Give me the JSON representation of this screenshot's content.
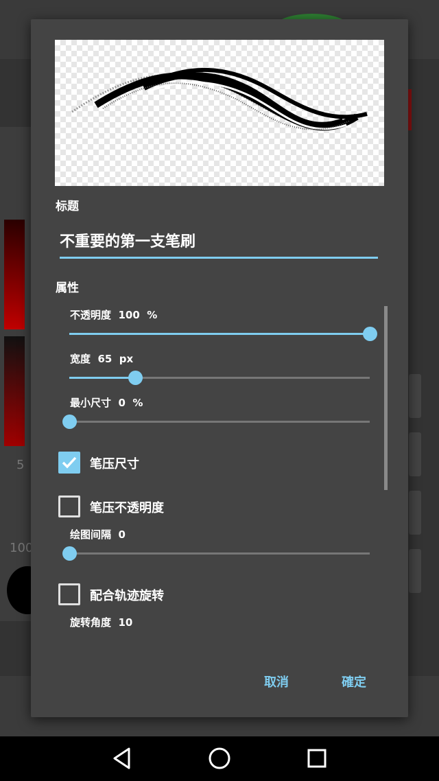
{
  "background": {
    "left_numbers": [
      "5",
      "100"
    ]
  },
  "dialog": {
    "title_label": "标题",
    "title_value": "不重要的第一支笔刷",
    "properties_label": "属性",
    "sliders": [
      {
        "name": "不透明度",
        "value": "100",
        "unit": "%",
        "fraction": 1.0
      },
      {
        "name": "宽度",
        "value": "65",
        "unit": "px",
        "fraction": 0.22
      },
      {
        "name": "最小尺寸",
        "value": "0",
        "unit": "%",
        "fraction": 0.0
      }
    ],
    "pressure_size": {
      "label": "笔压尺寸",
      "checked": true
    },
    "pressure_opacity": {
      "label": "笔压不透明度",
      "checked": false
    },
    "spacing": {
      "name": "绘图间隔",
      "value": "0",
      "unit": "",
      "fraction": 0.0
    },
    "follow_rotation": {
      "label": "配合轨迹旋转",
      "checked": false
    },
    "rotation_angle": {
      "name": "旋转角度",
      "value": "10",
      "unit": ""
    },
    "cancel_label": "取消",
    "ok_label": "確定"
  },
  "colors": {
    "accent": "#7fcdf0",
    "dialog_bg": "#444444"
  }
}
